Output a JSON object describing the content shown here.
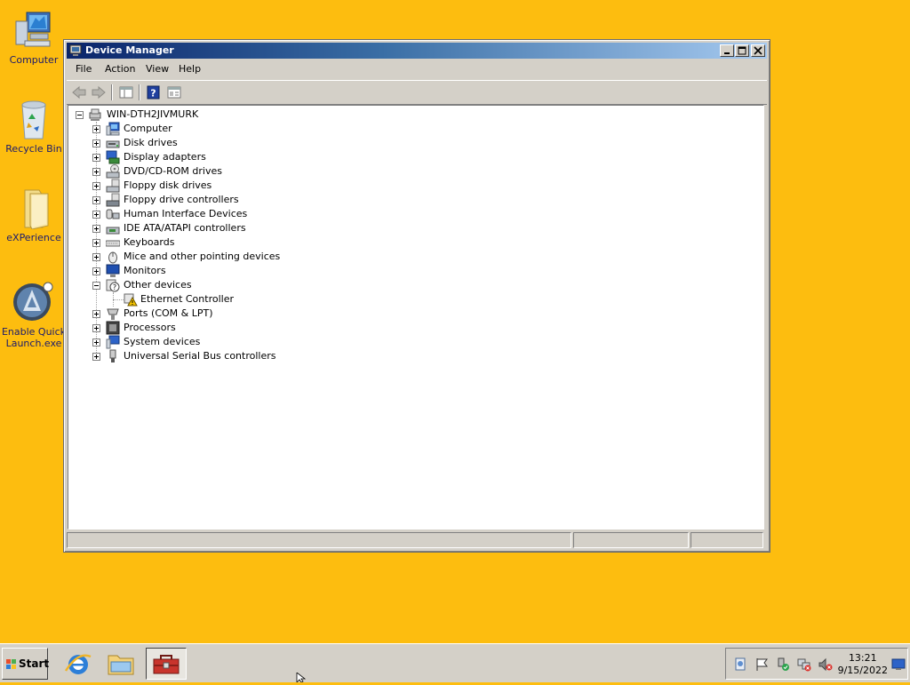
{
  "desktop": {
    "icons": [
      {
        "label": "Computer",
        "icon": "computer-icon"
      },
      {
        "label": "Recycle Bin",
        "icon": "recycle-bin-icon"
      },
      {
        "label": "eXPerience",
        "icon": "folder-icon"
      },
      {
        "label_line1": "Enable Quick",
        "label_line2": "Launch.exe",
        "icon": "app-icon"
      }
    ]
  },
  "window": {
    "title": "Device Manager",
    "menu": {
      "file": "File",
      "action": "Action",
      "view": "View",
      "help": "Help"
    },
    "toolbar": [
      "back-icon",
      "forward-icon",
      "show-hide-console-tree-icon",
      "help-icon",
      "properties-icon"
    ],
    "tree": {
      "root": "WIN-DTH2JIVMURK",
      "items": [
        {
          "label": "Computer",
          "icon": "computer-icon",
          "expanded": false
        },
        {
          "label": "Disk drives",
          "icon": "disk-drive-icon",
          "expanded": false
        },
        {
          "label": "Display adapters",
          "icon": "display-adapter-icon",
          "expanded": false
        },
        {
          "label": "DVD/CD-ROM drives",
          "icon": "dvd-drive-icon",
          "expanded": false
        },
        {
          "label": "Floppy disk drives",
          "icon": "floppy-drive-icon",
          "expanded": false
        },
        {
          "label": "Floppy drive controllers",
          "icon": "floppy-controller-icon",
          "expanded": false
        },
        {
          "label": "Human Interface Devices",
          "icon": "hid-icon",
          "expanded": false
        },
        {
          "label": "IDE ATA/ATAPI controllers",
          "icon": "ide-controller-icon",
          "expanded": false
        },
        {
          "label": "Keyboards",
          "icon": "keyboard-icon",
          "expanded": false
        },
        {
          "label": "Mice and other pointing devices",
          "icon": "mouse-icon",
          "expanded": false
        },
        {
          "label": "Monitors",
          "icon": "monitor-icon",
          "expanded": false
        },
        {
          "label": "Other devices",
          "icon": "unknown-device-icon",
          "expanded": true,
          "children": [
            {
              "label": "Ethernet Controller",
              "icon": "warning-device-icon"
            }
          ]
        },
        {
          "label": "Ports (COM & LPT)",
          "icon": "port-icon",
          "expanded": false
        },
        {
          "label": "Processors",
          "icon": "processor-icon",
          "expanded": false
        },
        {
          "label": "System devices",
          "icon": "system-device-icon",
          "expanded": false
        },
        {
          "label": "Universal Serial Bus controllers",
          "icon": "usb-icon",
          "expanded": false
        }
      ]
    }
  },
  "taskbar": {
    "start_label": "Start",
    "quick_launch": [
      "internet-explorer-icon",
      "explorer-icon",
      "device-manager-icon"
    ],
    "clock_time": "13:21",
    "clock_date": "9/15/2022"
  },
  "colors": {
    "desktop": "#fdbd0f",
    "titlebar": "#0a246a"
  }
}
